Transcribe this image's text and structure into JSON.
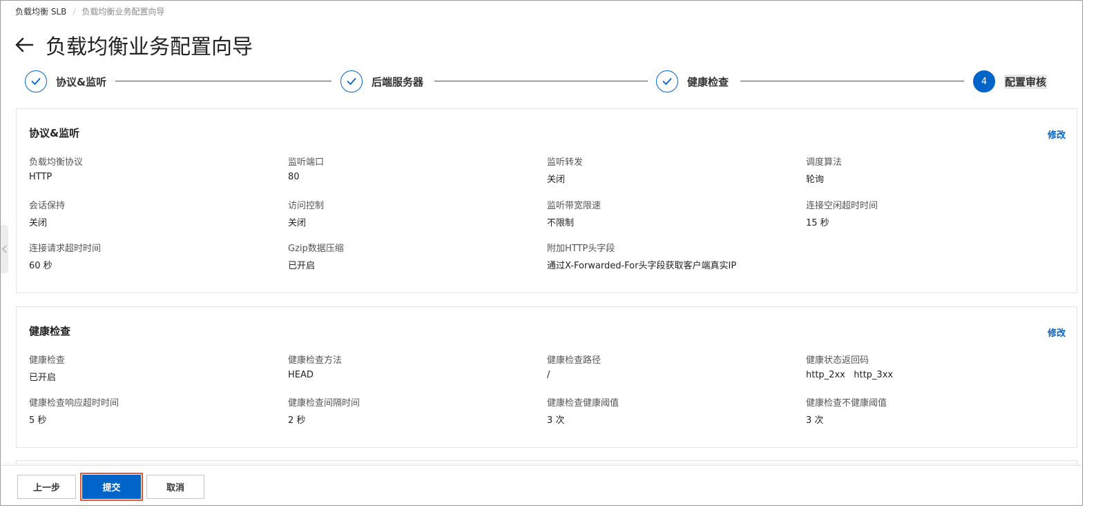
{
  "breadcrumb": {
    "root": "负载均衡 SLB",
    "separator": "/",
    "current": "负载均衡业务配置向导"
  },
  "header": {
    "title": "负载均衡业务配置向导",
    "back_icon": "arrow-left-icon"
  },
  "steps": [
    {
      "label": "协议&监听",
      "status": "done"
    },
    {
      "label": "后端服务器",
      "status": "done"
    },
    {
      "label": "健康检查",
      "status": "done"
    },
    {
      "label": "配置审核",
      "status": "current",
      "number": "4"
    }
  ],
  "colors": {
    "primary": "#0064c8",
    "highlight_border": "#e25a3a"
  },
  "listener_card": {
    "title": "协议&监听",
    "edit_label": "修改",
    "fields": [
      {
        "label": "负载均衡协议",
        "value": "HTTP"
      },
      {
        "label": "监听端口",
        "value": "80"
      },
      {
        "label": "监听转发",
        "value": "关闭"
      },
      {
        "label": "调度算法",
        "value": "轮询"
      },
      {
        "label": "会话保持",
        "value": "关闭"
      },
      {
        "label": "访问控制",
        "value": "关闭"
      },
      {
        "label": "监听带宽限速",
        "value": "不限制"
      },
      {
        "label": "连接空闲超时时间",
        "value": "15 秒"
      },
      {
        "label": "连接请求超时时间",
        "value": "60 秒"
      },
      {
        "label": "Gzip数据压缩",
        "value": "已开启"
      },
      {
        "label": "附加HTTP头字段",
        "value": "通过X-Forwarded-For头字段获取客户端真实IP"
      }
    ]
  },
  "health_card": {
    "title": "健康检查",
    "edit_label": "修改",
    "fields": [
      {
        "label": "健康检查",
        "value": "已开启"
      },
      {
        "label": "健康检查方法",
        "value": "HEAD"
      },
      {
        "label": "健康检查路径",
        "value": "/"
      },
      {
        "label": "健康状态返回码",
        "value": "http_2xx   http_3xx"
      },
      {
        "label": "健康检查响应超时时间",
        "value": "5 秒"
      },
      {
        "label": "健康检查间隔时间",
        "value": "2 秒"
      },
      {
        "label": "健康检查健康阈值",
        "value": "3 次"
      },
      {
        "label": "健康检查不健康阈值",
        "value": "3 次"
      }
    ]
  },
  "footer": {
    "prev_label": "上一步",
    "submit_label": "提交",
    "cancel_label": "取消"
  }
}
